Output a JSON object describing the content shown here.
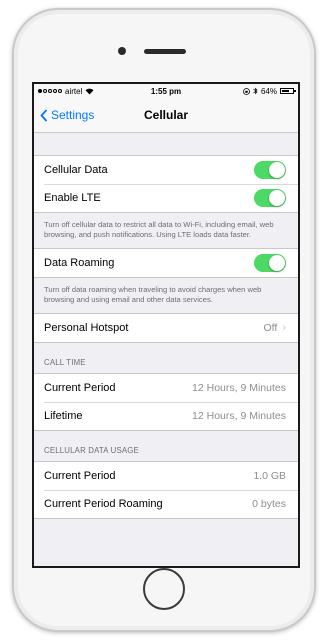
{
  "status_bar": {
    "carrier": "airtel",
    "time": "1:55 pm",
    "battery": "64%"
  },
  "nav": {
    "back_label": "Settings",
    "title": "Cellular"
  },
  "cellular_data": {
    "label": "Cellular Data",
    "on": true
  },
  "enable_lte": {
    "label": "Enable LTE",
    "on": true
  },
  "data_footer": "Turn off cellular data to restrict all data to Wi-Fi, including email, web browsing, and push notifications. Using LTE loads data faster.",
  "data_roaming": {
    "label": "Data Roaming",
    "on": true
  },
  "roaming_footer": "Turn off data roaming when traveling to avoid charges when web browsing and using email and other data services.",
  "hotspot": {
    "label": "Personal Hotspot",
    "value": "Off"
  },
  "call_time": {
    "header": "CALL TIME",
    "rows": [
      {
        "label": "Current Period",
        "value": "12 Hours, 9 Minutes"
      },
      {
        "label": "Lifetime",
        "value": "12 Hours, 9 Minutes"
      }
    ]
  },
  "data_usage": {
    "header": "CELLULAR DATA USAGE",
    "rows": [
      {
        "label": "Current Period",
        "value": "1.0 GB"
      },
      {
        "label": "Current Period Roaming",
        "value": "0 bytes"
      }
    ]
  },
  "colors": {
    "accent": "#007aff",
    "toggle_on": "#4cd964",
    "background": "#efeff4"
  }
}
